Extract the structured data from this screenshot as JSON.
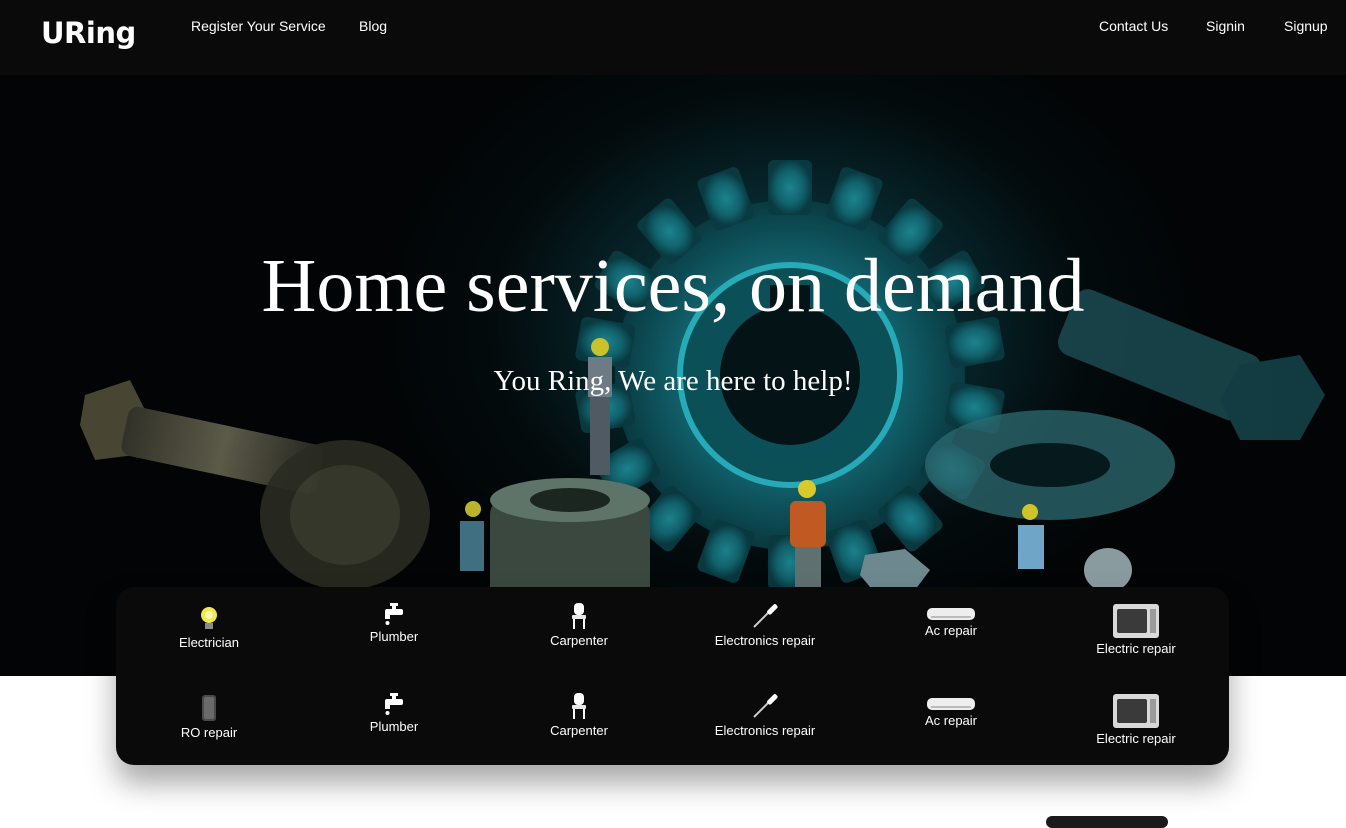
{
  "brand": {
    "logo": "URing"
  },
  "nav": {
    "left": [
      {
        "label": "Register Your Service"
      },
      {
        "label": "Blog"
      }
    ],
    "right": [
      {
        "label": "Contact Us"
      },
      {
        "label": "Signin"
      },
      {
        "label": "Signup"
      }
    ]
  },
  "hero": {
    "title": "Home services, on demand",
    "subtitle": "You Ring, We are here to help!"
  },
  "services": {
    "row1": [
      {
        "label": "Electrician",
        "icon": "bulb-icon"
      },
      {
        "label": "Plumber",
        "icon": "faucet-icon"
      },
      {
        "label": "Carpenter",
        "icon": "chair-icon"
      },
      {
        "label": "Electronics repair",
        "icon": "screwdriver-icon"
      },
      {
        "label": "Ac repair",
        "icon": "ac-unit-icon"
      },
      {
        "label": "Electric repair",
        "icon": "microwave-icon"
      }
    ],
    "row2": [
      {
        "label": "RO repair",
        "icon": "water-filter-icon"
      },
      {
        "label": "Plumber",
        "icon": "faucet-icon"
      },
      {
        "label": "Carpenter",
        "icon": "chair-icon"
      },
      {
        "label": "Electronics repair",
        "icon": "screwdriver-icon"
      },
      {
        "label": "Ac repair",
        "icon": "ac-unit-icon"
      },
      {
        "label": "Electric repair",
        "icon": "microwave-icon"
      }
    ]
  },
  "colors": {
    "navbar": "#0a0a0a",
    "card": "#0a0a0a",
    "hero_glow": "#0d4a52",
    "text": "#ffffff"
  }
}
